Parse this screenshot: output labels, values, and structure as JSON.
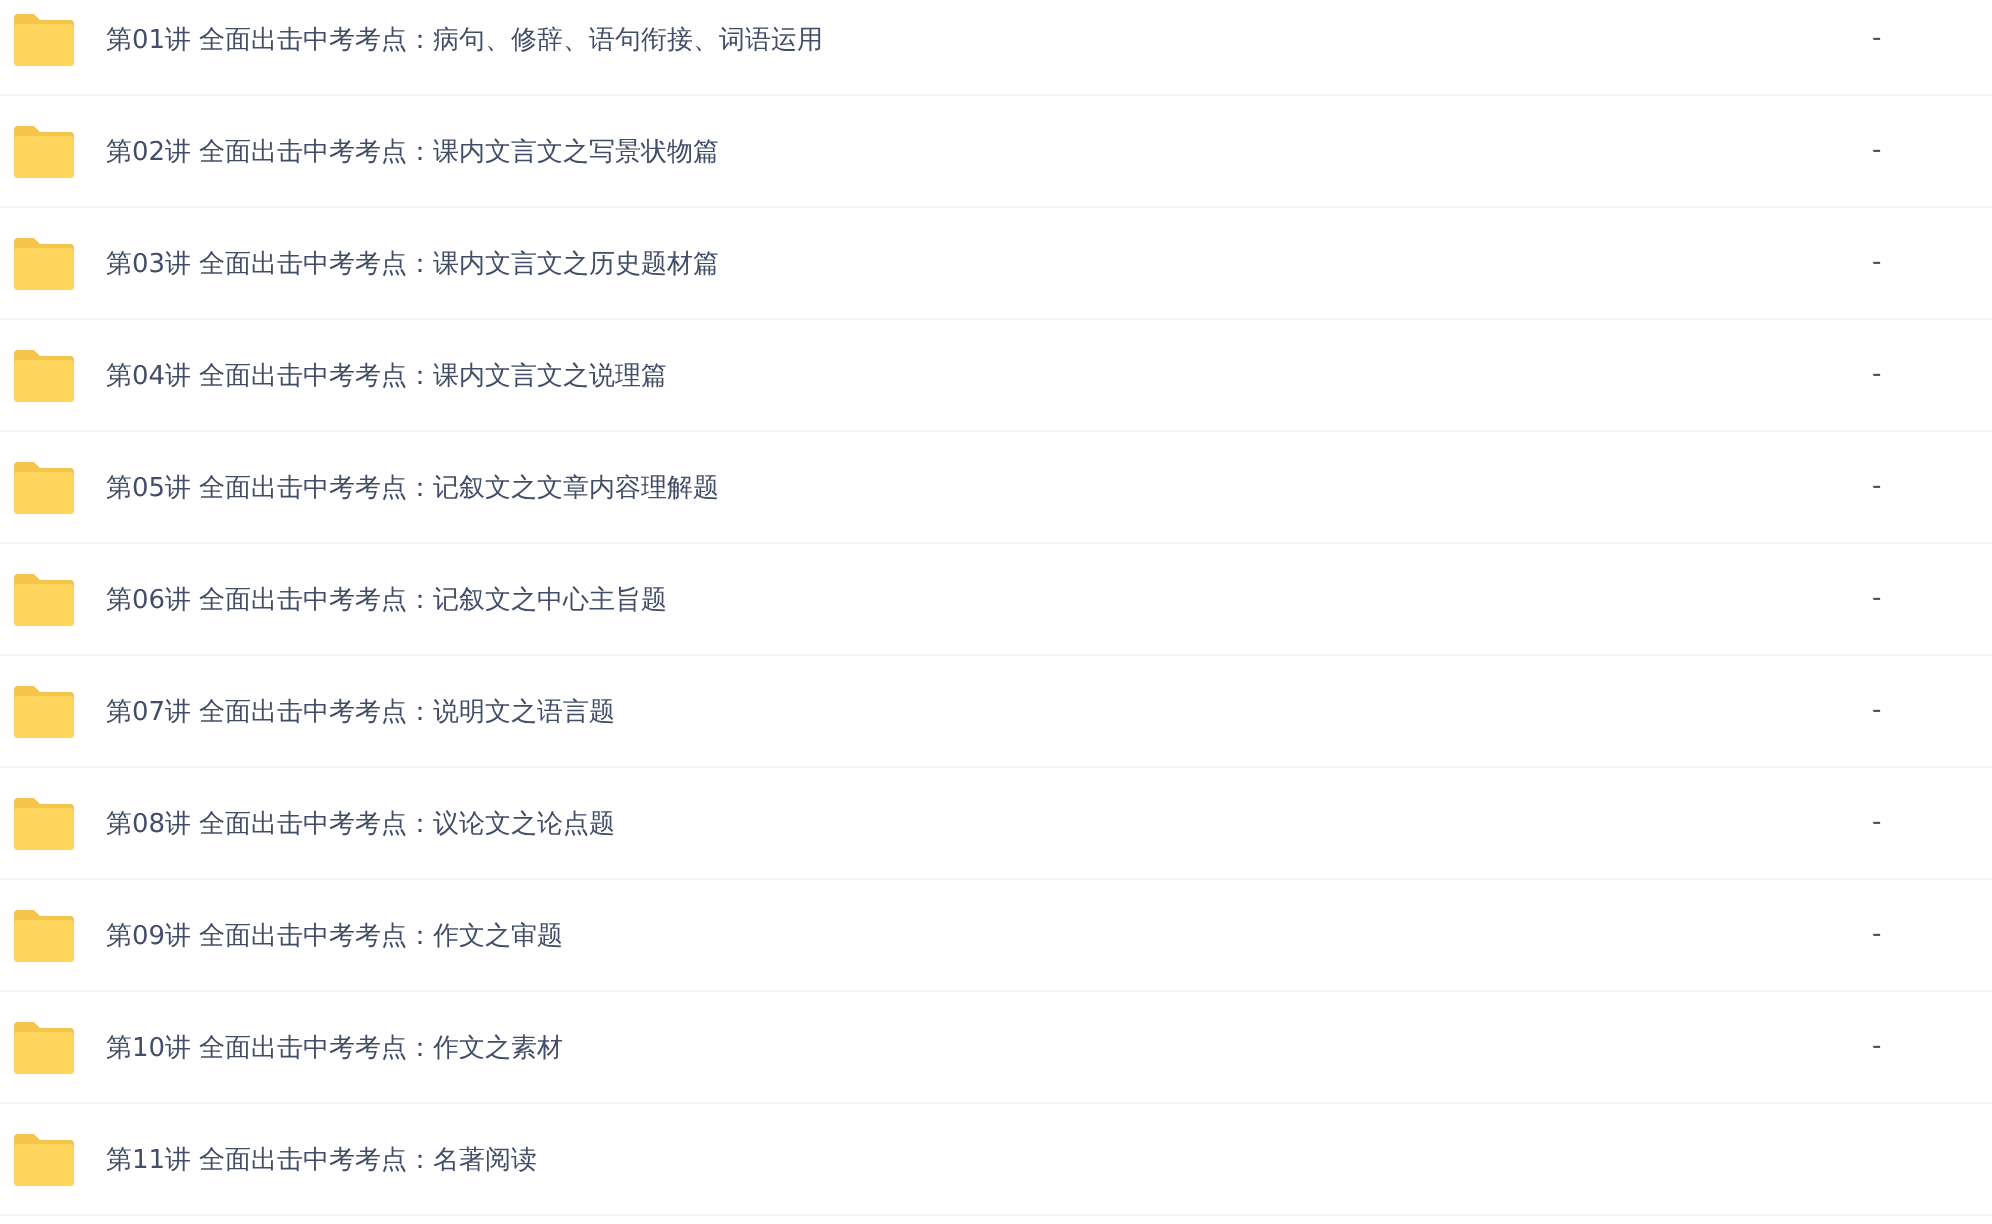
{
  "files": [
    {
      "name": "第01讲 全面出击中考考点：病句、修辞、语句衔接、词语运用",
      "size": "-"
    },
    {
      "name": "第02讲 全面出击中考考点：课内文言文之写景状物篇",
      "size": "-"
    },
    {
      "name": "第03讲 全面出击中考考点：课内文言文之历史题材篇",
      "size": "-"
    },
    {
      "name": "第04讲 全面出击中考考点：课内文言文之说理篇",
      "size": "-"
    },
    {
      "name": "第05讲 全面出击中考考点：记叙文之文章内容理解题",
      "size": "-"
    },
    {
      "name": "第06讲 全面出击中考考点：记叙文之中心主旨题",
      "size": "-"
    },
    {
      "name": "第07讲 全面出击中考考点：说明文之语言题",
      "size": "-"
    },
    {
      "name": "第08讲 全面出击中考考点：议论文之论点题",
      "size": "-"
    },
    {
      "name": "第09讲 全面出击中考考点：作文之审题",
      "size": "-"
    },
    {
      "name": "第10讲 全面出击中考考点：作文之素材",
      "size": "-"
    },
    {
      "name": "第11讲 全面出击中考考点：名著阅读"
    }
  ]
}
